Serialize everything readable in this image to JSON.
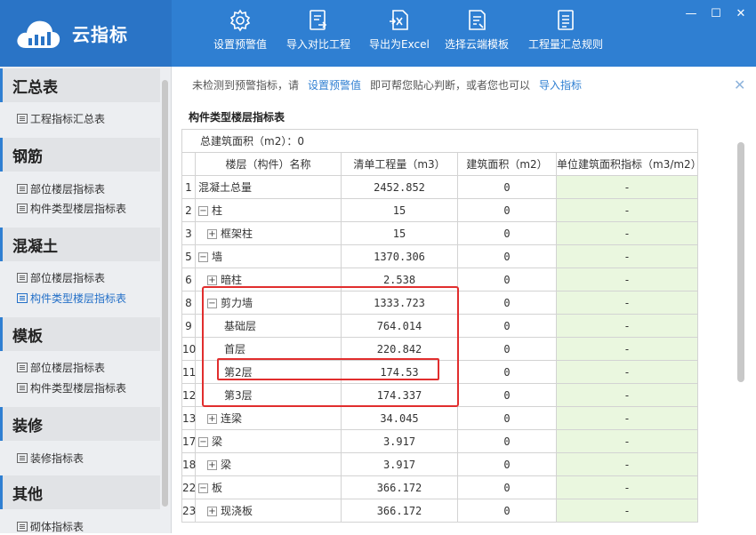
{
  "app": {
    "name": "云指标"
  },
  "toolbar": [
    {
      "label": "设置预警值",
      "icon": "gear-icon"
    },
    {
      "label": "导入对比工程",
      "icon": "import-compare-icon"
    },
    {
      "label": "导出为Excel",
      "icon": "excel-icon"
    },
    {
      "label": "选择云端模板",
      "icon": "template-icon"
    },
    {
      "label": "工程量汇总规则",
      "icon": "rules-icon"
    }
  ],
  "window": {
    "min": "—",
    "max": "☐",
    "close": "✕"
  },
  "sidebar": {
    "categories": [
      {
        "label": "汇总表",
        "items": [
          "工程指标汇总表"
        ]
      },
      {
        "label": "钢筋",
        "items": [
          "部位楼层指标表",
          "构件类型楼层指标表"
        ]
      },
      {
        "label": "混凝土",
        "items": [
          "部位楼层指标表",
          "构件类型楼层指标表"
        ]
      },
      {
        "label": "模板",
        "items": [
          "部位楼层指标表",
          "构件类型楼层指标表"
        ]
      },
      {
        "label": "装修",
        "items": [
          "装修指标表"
        ]
      },
      {
        "label": "其他",
        "items": [
          "砌体指标表"
        ]
      }
    ]
  },
  "notice": {
    "text1": "未检测到预警指标，请",
    "link1": "设置预警值",
    "text2": "即可帮您贴心判断，或者您也可以",
    "link2": "导入指标",
    "close": "✕"
  },
  "table": {
    "title": "构件类型楼层指标表",
    "total_area": "总建筑面积（m2）：0",
    "headers": [
      "楼层（构件）名称",
      "清单工程量（m3）",
      "建筑面积（m2）",
      "单位建筑面积指标（m3/m2）"
    ],
    "rows": [
      {
        "n": "1",
        "name": "混凝土总量",
        "qty": "2452.852",
        "area": "0",
        "idx": "-"
      },
      {
        "n": "2",
        "name": "柱",
        "qty": "15",
        "area": "0",
        "idx": "-"
      },
      {
        "n": "3",
        "name": "框架柱",
        "qty": "15",
        "area": "0",
        "idx": "-"
      },
      {
        "n": "5",
        "name": "墙",
        "qty": "1370.306",
        "area": "0",
        "idx": "-"
      },
      {
        "n": "6",
        "name": "暗柱",
        "qty": "2.538",
        "area": "0",
        "idx": "-"
      },
      {
        "n": "8",
        "name": "剪力墙",
        "qty": "1333.723",
        "area": "0",
        "idx": "-"
      },
      {
        "n": "9",
        "name": "基础层",
        "qty": "764.014",
        "area": "0",
        "idx": "-"
      },
      {
        "n": "10",
        "name": "首层",
        "qty": "220.842",
        "area": "0",
        "idx": "-"
      },
      {
        "n": "11",
        "name": "第2层",
        "qty": "174.53",
        "area": "0",
        "idx": "-"
      },
      {
        "n": "12",
        "name": "第3层",
        "qty": "174.337",
        "area": "0",
        "idx": "-"
      },
      {
        "n": "13",
        "name": "连梁",
        "qty": "34.045",
        "area": "0",
        "idx": "-"
      },
      {
        "n": "17",
        "name": "梁",
        "qty": "3.917",
        "area": "0",
        "idx": "-"
      },
      {
        "n": "18",
        "name": "梁",
        "qty": "3.917",
        "area": "0",
        "idx": "-"
      },
      {
        "n": "22",
        "name": "板",
        "qty": "366.172",
        "area": "0",
        "idx": "-"
      },
      {
        "n": "23",
        "name": "现浇板",
        "qty": "366.172",
        "area": "0",
        "idx": "-"
      }
    ]
  },
  "colors": {
    "header": "#2f7fd2",
    "highlight": "#e12e2e",
    "green_cell": "#eaf7df",
    "link": "#2f7fd2"
  }
}
